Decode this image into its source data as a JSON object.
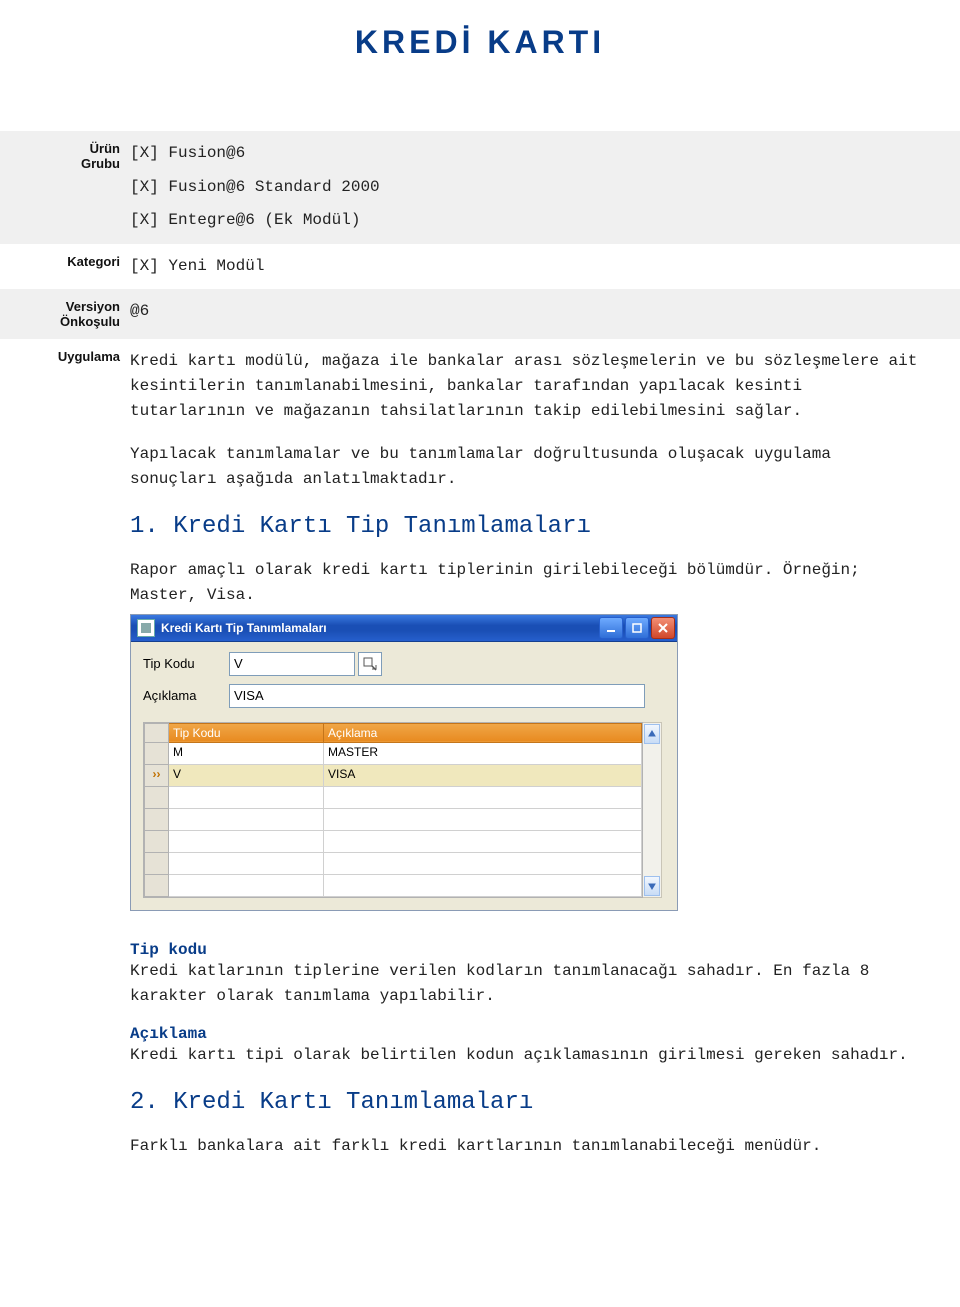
{
  "page_title": "KREDİ KARTI",
  "rows": {
    "urun_grubu_label1": "Ürün",
    "urun_grubu_label2": "Grubu",
    "urun_grubu_lines": [
      "[X] Fusion@6",
      "[X] Fusion@6 Standard 2000",
      "[X] Entegre@6 (Ek Modül)"
    ],
    "kategori_label": "Kategori",
    "kategori_value": "[X] Yeni Modül",
    "versiyon_label1": "Versiyon",
    "versiyon_label2": "Önkoşulu",
    "versiyon_value": "@6",
    "uygulama_label": "Uygulama",
    "uygulama_p1": "Kredi kartı modülü, mağaza ile bankalar arası sözleşmelerin ve bu sözleşmelere ait kesintilerin tanımlanabilmesini, bankalar tarafından yapılacak kesinti tutarlarının ve mağazanın tahsilatlarının takip edilebilmesini sağlar.",
    "uygulama_p2": "Yapılacak tanımlamalar ve bu tanımlamalar doğrultusunda oluşacak uygulama sonuçları aşağıda anlatılmaktadır.",
    "sec1_title": "1. Kredi Kartı Tip Tanımlamaları",
    "sec1_body": "Rapor amaçlı olarak kredi kartı tiplerinin girilebileceği bölümdür. Örneğin; Master, Visa.",
    "field_tipkodu_head": "Tip kodu",
    "field_tipkodu_body": "Kredi katlarının tiplerine verilen kodların tanımlanacağı sahadır. En fazla 8 karakter olarak tanımlama yapılabilir.",
    "field_aciklama_head": "Açıklama",
    "field_aciklama_body": "Kredi kartı tipi olarak belirtilen kodun açıklamasının girilmesi gereken sahadır.",
    "sec2_title": "2. Kredi Kartı Tanımlamaları",
    "sec2_body": "Farklı bankalara ait farklı kredi kartlarının tanımlanabileceği menüdür."
  },
  "window": {
    "title": "Kredi Kartı Tip Tanımlamaları",
    "form": {
      "tipkodu_label": "Tip Kodu",
      "tipkodu_value": "V",
      "aciklama_label": "Açıklama",
      "aciklama_value": "VISA"
    },
    "grid": {
      "col1": "Tip Kodu",
      "col2": "Açıklama",
      "rows": [
        {
          "c1": "M",
          "c2": "MASTER",
          "active": false
        },
        {
          "c1": "V",
          "c2": "VISA",
          "active": true
        }
      ],
      "empty_rows": 5
    }
  }
}
